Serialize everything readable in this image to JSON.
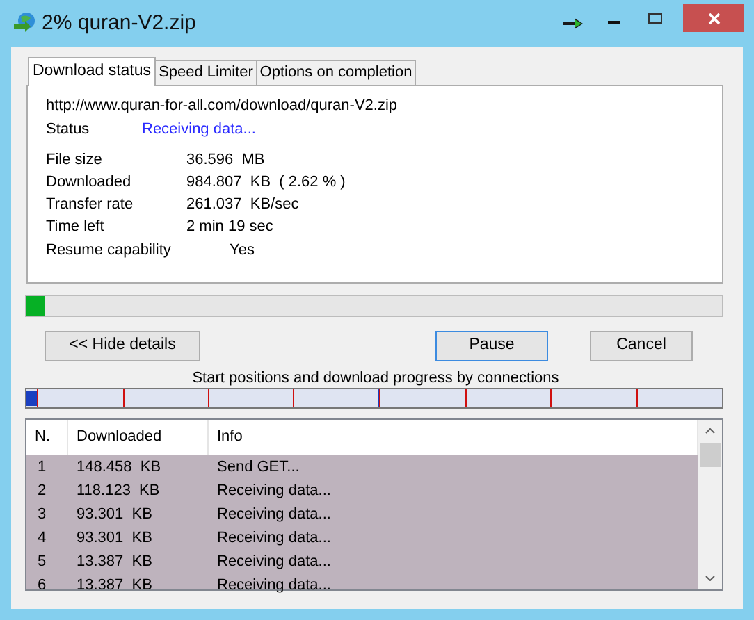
{
  "window": {
    "title": "2% quran-V2.zip"
  },
  "tabs": [
    {
      "label": "Download status",
      "selected": true
    },
    {
      "label": "Speed Limiter",
      "selected": false
    },
    {
      "label": "Options on completion",
      "selected": false
    }
  ],
  "url": "http://www.quran-for-all.com/download/quran-V2.zip",
  "status": {
    "label": "Status",
    "value": "Receiving data..."
  },
  "details": [
    {
      "label": "File size",
      "value": "36.596  MB"
    },
    {
      "label": "Downloaded",
      "value": "984.807  KB  ( 2.62 % )"
    },
    {
      "label": "Transfer rate",
      "value": "261.037  KB/sec"
    },
    {
      "label": "Time left",
      "value": "2 min 19 sec"
    }
  ],
  "resume": {
    "label": "Resume capability",
    "value": "Yes"
  },
  "progress": {
    "level": 0.0262
  },
  "buttons": [
    {
      "label": "<< Hide details",
      "focused": false
    },
    {
      "label": "Pause",
      "focused": true
    },
    {
      "label": "Cancel",
      "focused": false
    }
  ],
  "connections_caption": "Start positions and download progress by connections",
  "table": {
    "columns": [
      "N.",
      "Downloaded",
      "Info"
    ],
    "rows": [
      [
        "1",
        "148.458  KB",
        "Send GET..."
      ],
      [
        "2",
        "118.123  KB",
        "Receiving data..."
      ],
      [
        "3",
        "93.301  KB",
        "Receiving data..."
      ],
      [
        "4",
        "93.301  KB",
        "Receiving data..."
      ],
      [
        "5",
        "13.387  KB",
        "Receiving data..."
      ],
      [
        "6",
        "13.387  KB",
        "Receiving data..."
      ]
    ]
  }
}
